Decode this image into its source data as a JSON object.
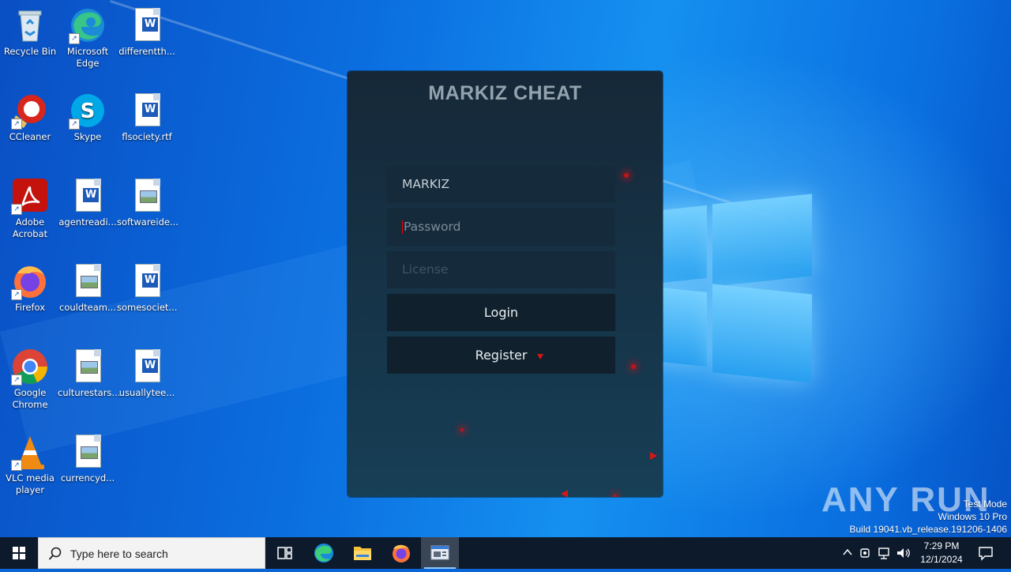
{
  "desktop": {
    "icons": [
      {
        "label": "Recycle Bin"
      },
      {
        "label": "Microsoft Edge"
      },
      {
        "label": "differentth..."
      },
      {
        "label": "CCleaner"
      },
      {
        "label": "Skype"
      },
      {
        "label": "flsociety.rtf"
      },
      {
        "label": "Adobe Acrobat"
      },
      {
        "label": "agentreadi..."
      },
      {
        "label": "softwareide..."
      },
      {
        "label": "Firefox"
      },
      {
        "label": "couldteam..."
      },
      {
        "label": "somesociet..."
      },
      {
        "label": "Google Chrome"
      },
      {
        "label": "culturestars..."
      },
      {
        "label": "usuallytee..."
      },
      {
        "label": "VLC media player"
      },
      {
        "label": "currencyd..."
      }
    ]
  },
  "dialog": {
    "title": "MARKIZ CHEAT",
    "username_value": "MARKIZ",
    "password_placeholder": "Password",
    "license_placeholder": "License",
    "login_label": "Login",
    "register_label": "Register"
  },
  "watermark": {
    "logo": "ANY RUN",
    "mode": "Test Mode",
    "os": "Windows 10 Pro",
    "build": "Build 19041.vb_release.191206-1406"
  },
  "taskbar": {
    "search_placeholder": "Type here to search",
    "time": "7:29 PM",
    "date": "12/1/2024"
  },
  "colors": {
    "accent": "#0a66d6",
    "dialog_bg": "#162838",
    "particle": "#c0141a",
    "taskbar": "#0c1a2c"
  }
}
